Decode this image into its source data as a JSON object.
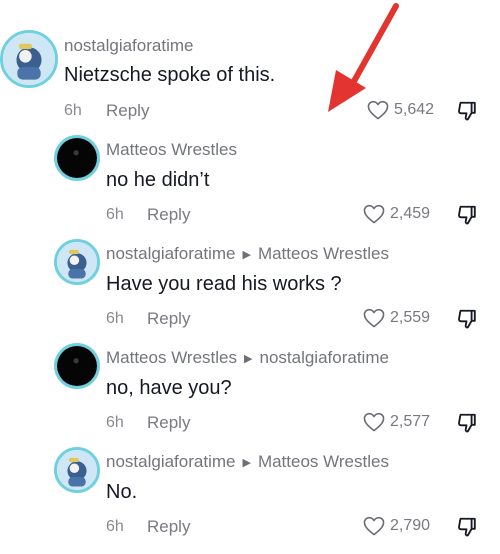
{
  "comments": [
    {
      "username": "nostalgiaforatime",
      "reply_to": "",
      "text": "Nietzsche spoke of this.",
      "time": "6h",
      "reply_label": "Reply",
      "likes": "5,642",
      "avatar": "cartoon-avatar"
    },
    {
      "username": "Matteos Wrestles",
      "reply_to": "",
      "text": "no he didn’t",
      "time": "6h",
      "reply_label": "Reply",
      "likes": "2,459",
      "avatar": "dark-avatar"
    },
    {
      "username": "nostalgiaforatime",
      "reply_to": "Matteos Wrestles",
      "text": "Have you read his works ?",
      "time": "6h",
      "reply_label": "Reply",
      "likes": "2,559",
      "avatar": "cartoon-avatar"
    },
    {
      "username": "Matteos Wrestles",
      "reply_to": "nostalgiaforatime",
      "text": "no, have you?",
      "time": "6h",
      "reply_label": "Reply",
      "likes": "2,577",
      "avatar": "dark-avatar"
    },
    {
      "username": "nostalgiaforatime",
      "reply_to": "Matteos Wrestles",
      "text": "No.",
      "time": "6h",
      "reply_label": "Reply",
      "likes": "2,790",
      "avatar": "cartoon-avatar"
    }
  ],
  "icons": {
    "like": "heart-outline-icon",
    "dislike": "thumbs-down-icon",
    "reply_separator": "triangle-right-icon",
    "annotation": "red-arrow-icon"
  },
  "colors": {
    "annotation_arrow": "#e3342f",
    "avatar_ring": "#6fd0e0",
    "username": "#73757c",
    "text": "#161823"
  }
}
